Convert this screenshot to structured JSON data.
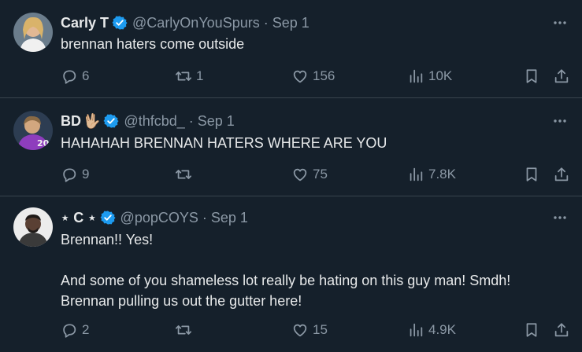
{
  "tweets": [
    {
      "display_name": "Carly T",
      "handle": "@CarlyOnYouSpurs",
      "separator": "·",
      "date": "Sep 1",
      "emoji": "",
      "text": "brennan haters come outside",
      "replies": "6",
      "retweets": "1",
      "likes": "156",
      "views": "10K",
      "avatar_colors": [
        "#c9a77c",
        "#5b4a3f"
      ]
    },
    {
      "display_name": "BD",
      "handle": "@thfcbd_",
      "separator": "·",
      "date": "Sep 1",
      "emoji": "🖖🏼",
      "text": "HAHAHAH BRENNAN HATERS WHERE ARE YOU",
      "replies": "9",
      "retweets": "",
      "likes": "75",
      "views": "7.8K",
      "avatar_colors": [
        "#3b2a6b",
        "#b24fd8"
      ]
    },
    {
      "display_name": "⋆ C ⋆",
      "handle": "@popCOYS",
      "separator": "·",
      "date": "Sep 1",
      "emoji": "",
      "text": "Brennan!! Yes!\n\nAnd some of you shameless lot really be hating on this guy man! Smdh!\nBrennan pulling us out the gutter here!",
      "replies": "2",
      "retweets": "",
      "likes": "15",
      "views": "4.9K",
      "avatar_colors": [
        "#e8e8e8",
        "#3a2d28"
      ]
    }
  ],
  "icons": {
    "more": "more-horizontal-icon",
    "reply": "reply-icon",
    "retweet": "retweet-icon",
    "like": "heart-icon",
    "views": "views-chart-icon",
    "bookmark": "bookmark-icon",
    "share": "share-icon",
    "verified": "verified-badge-icon"
  },
  "colors": {
    "background": "#15202b",
    "text": "#e7e9ea",
    "muted": "#8b98a5",
    "divider": "#38444d",
    "verified": "#1d9bf0"
  }
}
